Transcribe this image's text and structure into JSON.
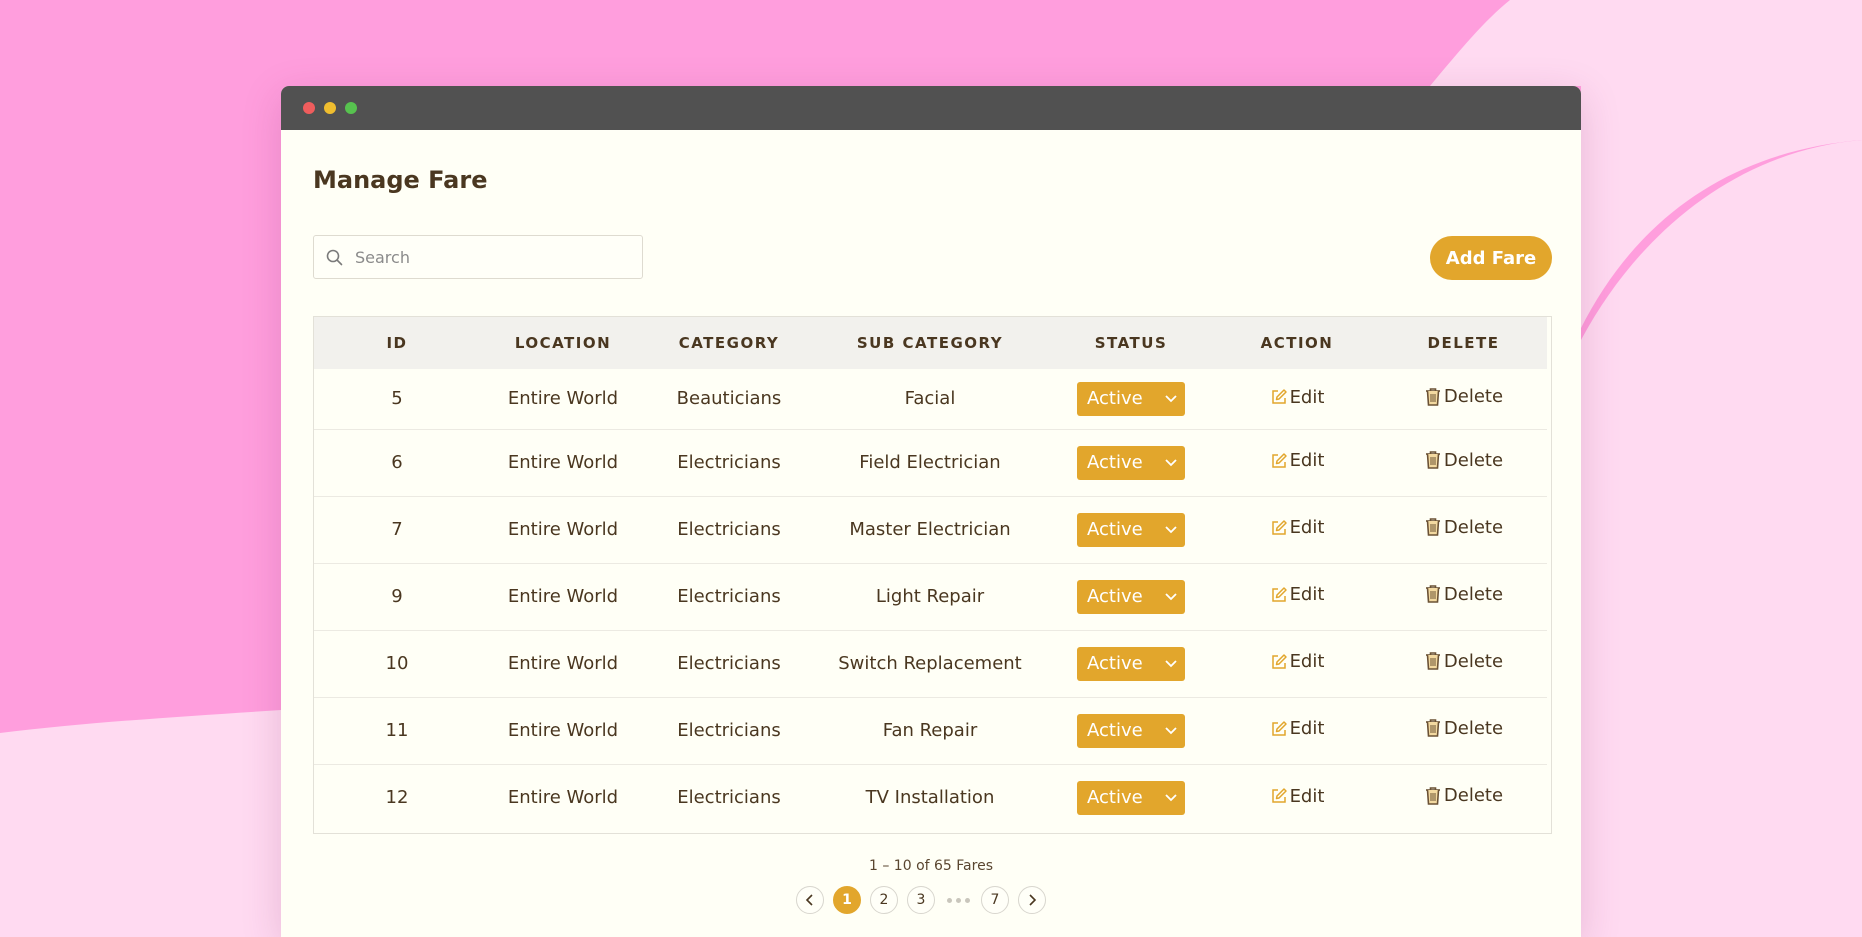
{
  "colors": {
    "background": "#ff9edd",
    "background_light": "#ffdaf1",
    "accent": "#e2a62c",
    "titlebar": "#515151",
    "window": "#fffff6",
    "text": "#4a3720",
    "traffic_red": "#ef5d5d",
    "traffic_yellow": "#efbd2f",
    "traffic_green": "#57c24f"
  },
  "page": {
    "title": "Manage Fare"
  },
  "search": {
    "placeholder": "Search",
    "value": "",
    "icon": "search-icon"
  },
  "toolbar": {
    "add_label": "Add Fare"
  },
  "table": {
    "headers": [
      "ID",
      "LOCATION",
      "CATEGORY",
      "SUB CATEGORY",
      "STATUS",
      "ACTION",
      "DELETE"
    ],
    "rows": [
      {
        "id": "5",
        "location": "Entire World",
        "category": "Beauticians",
        "sub_category": "Facial",
        "status": "Active"
      },
      {
        "id": "6",
        "location": "Entire World",
        "category": "Electricians",
        "sub_category": "Field Electrician",
        "status": "Active"
      },
      {
        "id": "7",
        "location": "Entire World",
        "category": "Electricians",
        "sub_category": "Master Electrician",
        "status": "Active"
      },
      {
        "id": "9",
        "location": "Entire World",
        "category": "Electricians",
        "sub_category": "Light Repair",
        "status": "Active"
      },
      {
        "id": "10",
        "location": "Entire World",
        "category": "Electricians",
        "sub_category": "Switch Replacement",
        "status": "Active"
      },
      {
        "id": "11",
        "location": "Entire World",
        "category": "Electricians",
        "sub_category": "Fan Repair",
        "status": "Active"
      },
      {
        "id": "12",
        "location": "Entire World",
        "category": "Electricians",
        "sub_category": "TV Installation",
        "status": "Active"
      }
    ],
    "edit_label": "Edit",
    "delete_label": "Delete",
    "edit_icon": "edit-icon",
    "delete_icon": "trash-icon"
  },
  "pagination": {
    "info": "1 – 10 of 65 Fares",
    "pages": [
      "1",
      "2",
      "3",
      "7"
    ],
    "current": "1"
  }
}
